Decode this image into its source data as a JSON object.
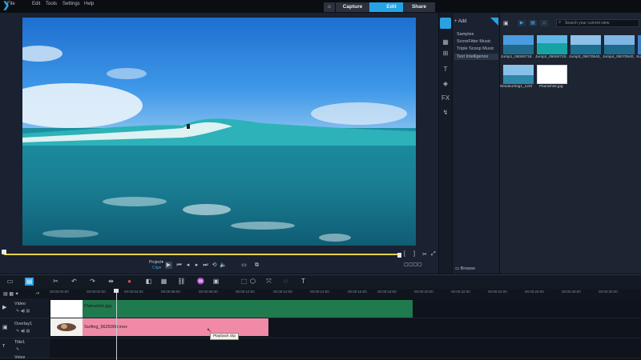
{
  "menu": [
    "File",
    "Edit",
    "Tools",
    "Settings",
    "Help"
  ],
  "tabs": {
    "capture": "Capture",
    "edit": "Edit",
    "share": "Share"
  },
  "player": {
    "project_label": "Project▾",
    "clip_label": "Clip▾"
  },
  "library": {
    "add_label": "Add",
    "categories": [
      "Samples",
      "ScoreFitter Music",
      "Triple Scoop Music",
      "Text Intelligence"
    ],
    "browse_label": "Browse",
    "search_placeholder": "Search your current view",
    "thumbs": [
      "Jump1_05060718.mov",
      "Jump2_05060720.mov",
      "Jump3_05070540_V...",
      "Jump4_05070540_V...",
      "Su",
      "Windsurfing1_12456...",
      "Plainwhite.jpg"
    ]
  },
  "timeline": {
    "ruler": [
      "00:00:00:00",
      "00:00:02:00",
      "00:00:04:00",
      "00:00:06:00",
      "00:00:08:00",
      "00:00:10:00",
      "00:00:12:00",
      "00:00:14:00",
      "00:00:16:00",
      "00:00:18:00",
      "00:00:20:00",
      "00:00:22:00",
      "00:00:24:00",
      "00:00:26:00",
      "00:00:28:00",
      "00:00:30:00"
    ],
    "tracks": [
      "Video",
      "Overlay1",
      "Title1",
      "Voice"
    ],
    "clip_video": "Plainwhite.jpg",
    "clip_overlay": "Surfing_5625008.mov",
    "tooltip": "Playback clip"
  },
  "colors": {
    "accent": "#25a3e6",
    "video_clip": "#1f7a4d",
    "overlay_clip": "#f08aa6",
    "scrubber": "#e4d24a"
  }
}
